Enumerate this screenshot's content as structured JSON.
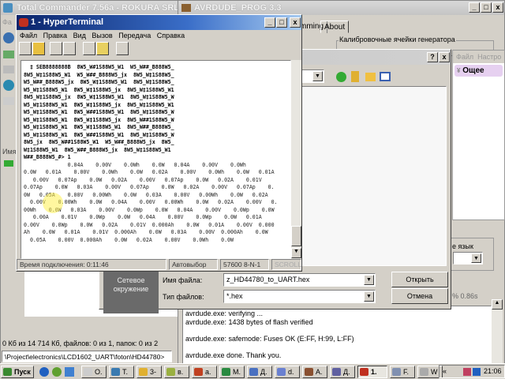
{
  "total_commander": {
    "title": "Total Commander 7.56a - ROKURA SRL",
    "menu_first": "Фа",
    "status": "0 Кб из 14 714 Кб, файлов: 0 из 1, папок: 0 из 2",
    "cmd_path": "\\Project\\electronics\\LCD1602_UART\\foton\\HD44780>",
    "side_label": "Имя"
  },
  "avrdude": {
    "title": "AVRDUDE_PROG 3.3",
    "tabs": [
      "mming",
      "About"
    ],
    "group_calib": "Калибровочные ячейки генератора",
    "group_lang": "е язык",
    "progress_text": "% 0.86s",
    "log": [
      "avrdude.exe: verifying ...",
      "avrdude.exe: 1438 bytes of flash verified",
      "",
      "avrdude.exe: safemode: Fuses OK (E:FF, H:99, L:FF)",
      "",
      "avrdude.exe done.  Thank you."
    ]
  },
  "open_dialog": {
    "help": "?",
    "close": "x",
    "network_label": "Сетевое окружение",
    "filename_label": "Имя файла:",
    "filename_value": "z_HD44780_to_UART.hex",
    "filetype_label": "Тип файлов:",
    "filetype_value": "*.hex",
    "open_button": "Открыть",
    "cancel_button": "Отмена"
  },
  "right_app": {
    "menu": [
      "Файл",
      "Настро"
    ],
    "item": "Ощее"
  },
  "hyperterminal": {
    "title": "1 - HyperTerminal",
    "menu": [
      "Файл",
      "Правка",
      "Вид",
      "Вызов",
      "Передача",
      "Справка"
    ],
    "garbage_lines": [
      "  ‡ SEB8888888B  8W5_W#1S88W5_W1  W5_W##_B888W5_",
      "8W5_W‡1S88W5_W1  W5_W##_B888W5_jx  8W5_W‡1S88W5_",
      "W5_W##_B888W5_jx  8W5_W‡1S88W5_W1  8W5_W‡1S88W5_",
      "W5_W‡1S88W5_W1  8W5_W‡1S88W5_jx  8W5_W‡1S88W5_W1",
      "8W5_W‡1S88W5_jx  8W5_W‡1S88W5_W1  8W5_W‡1S88W5_W",
      "W5_W‡1S88W5_W1  8W5_W‡1S88W5_jx  8W5_W‡1S88W5_W1",
      "W5_W‡1S88W5_W1  8W5_W##1S88W5_W1  8W5_W‡1S88W5_W",
      "W5_W‡1S88W5_W1  8W5_W‡1S88W5_jx  8W5_W##1S88W5_W",
      "W5_W‡1S88W5_W1  8W5_W‡1S88W5_W1  8W5_W##_B888W5_",
      "W5_W‡1S88W5_W1  8W5_W##1S88W5_W1  8W5_W‡1S88W5_W",
      "8W5_jx  8W5_W##1S88W5_W1  W5_W##_B888W5_jx  8W5_",
      "W‡1S88W5_W1  8W5_W##_B888W5_jx  8W5_W‡1S88W5_W1",
      "W##_B888W5_#> 1"
    ],
    "data_lines": [
      "              0.04A    0.00V    0.0Wh    0.0W   0.04A    0.00V    0.0Wh",
      "0.0W   0.01A    0.00V    0.0Wh    0.0W   0.02A    0.00V    0.0Wh    0.0W   0.01A",
      "   0.00V   0.07Ap    0.0W   0.02A    0.00V   0.07Ap    0.0W   0.02A    0.01V",
      "0.07Ap    0.0W   0.03A    0.00V   0.07Ap    0.0W   0.02A    0.00V   0.07Ap    0.",
      "0W   0.05A    0.00V   0.00Wh    0.0W   0.03A    0.00V   0.00Wh    0.0W   0.02A",
      "  0.00V    0.00Wh    0.0W   0.04A    0.00V   0.00Wh    0.0W   0.02A    0.00V   0.",
      "00Wh    0.0W   0.03A    0.00V    0.0Wp    0.0W   0.04A    0.00V    0.0Wp    0.0W",
      "   0.00A    0.01V    0.0Wp    0.0W   0.04A    0.00V    0.0Wp    0.0W   0.01A",
      "0.00V    0.0Wp    0.0W   0.02A    0.01V  0.000Ah    0.0W   0.01A    0.00V  0.000",
      "Ah    0.0W   0.01A    0.01V  0.000Ah    0.0W   0.03A    0.00V  0.000Ah    0.0W",
      "  0.05A    0.00V  0.000Ah    0.0W   0.02A    0.00V    0.0Wh    0.0W"
    ],
    "status": {
      "connected": "Время подключения: 0:11:46",
      "detect": "Автовыбор",
      "port": "57600 8-N-1",
      "scroll": "SCROLL"
    }
  },
  "taskbar": {
    "start": "Пуск",
    "items": [
      "O.",
      "T.",
      "3-",
      "в.",
      "a.",
      "M.",
      "Д.",
      "d.",
      "A.",
      "Д.",
      "1.",
      "F.",
      "W"
    ],
    "tray_arrow": "«",
    "clock": "21:06"
  },
  "colors": {
    "title_active": "#0a246a",
    "taskbar": "#d4d0c8",
    "highlight": "#e6d0f0"
  }
}
